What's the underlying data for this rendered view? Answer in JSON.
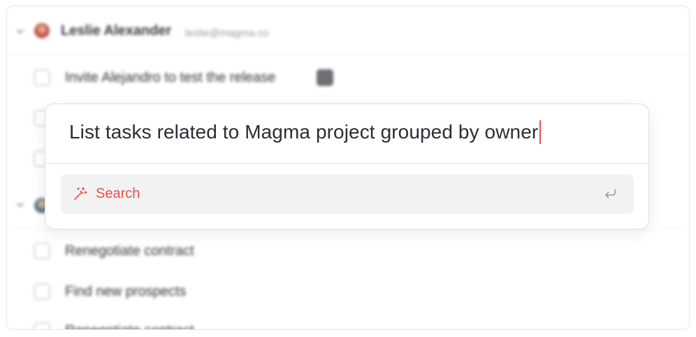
{
  "background": {
    "groups": [
      {
        "owner_name": "Leslie Alexander",
        "owner_email": "leslie@magma.co",
        "avatar_color": "#c25a4a",
        "tasks": [
          {
            "label": "Invite Alejandro to test the release",
            "has_tag": true
          },
          {
            "label": "",
            "has_tag": false
          },
          {
            "label": "",
            "has_tag": false
          }
        ]
      },
      {
        "owner_name": "",
        "owner_email": "",
        "avatar_color": "#5b7a8c",
        "tasks": [
          {
            "label": "Renegotiate contract",
            "has_tag": false
          },
          {
            "label": "Find new prospects",
            "has_tag": false
          },
          {
            "label": "Renegotiate contract",
            "has_tag": false
          }
        ]
      }
    ]
  },
  "command_palette": {
    "query": "List tasks related to Magma project grouped by owner",
    "options": [
      {
        "label": "Search",
        "icon": "magic-wand-icon",
        "shortcut_icon": "enter-key-icon"
      }
    ]
  },
  "colors": {
    "accent": "#e5534b",
    "option_bg": "#f2f2f3",
    "frame_border": "#e6e4f2"
  }
}
